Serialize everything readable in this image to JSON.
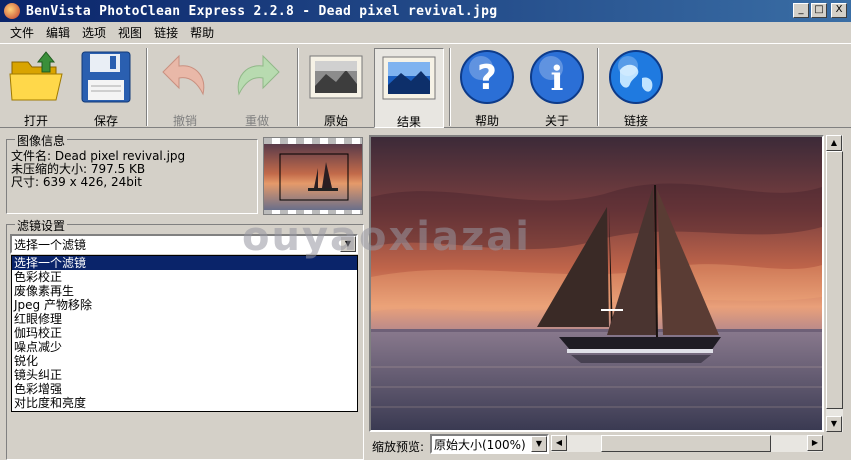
{
  "window": {
    "title": "BenVista PhotoClean Express 2.2.8 - Dead pixel revival.jpg",
    "controls": {
      "minimize": "_",
      "maximize": "□",
      "close": "X"
    }
  },
  "menu": [
    "文件",
    "编辑",
    "选项",
    "视图",
    "链接",
    "帮助"
  ],
  "toolbar": {
    "open": "打开",
    "save": "保存",
    "undo": "撤销",
    "redo": "重做",
    "original": "原始",
    "result": "结果",
    "help": "帮助",
    "about": "关于",
    "link": "链接"
  },
  "image_info": {
    "group_title": "图像信息",
    "filename": "文件名: Dead pixel revival.jpg",
    "uncompressed": "未压缩的大小: 797.5 KB",
    "dimensions": "尺寸: 639 x 426, 24bit"
  },
  "filter": {
    "group_title": "滤镜设置",
    "selected": "选择一个滤镜",
    "options": [
      "选择一个滤镜",
      "色彩校正",
      "废像素再生",
      "Jpeg 产物移除",
      "红眼修理",
      "伽玛校正",
      "噪点减少",
      "锐化",
      "镜头纠正",
      "色彩增强",
      "对比度和亮度"
    ]
  },
  "zoom": {
    "label": "缩放预览:",
    "value": "原始大小(100%)"
  },
  "watermark": "ouyaoxiazai",
  "icons": {
    "open": "folder-open-icon",
    "save": "floppy-disk-icon",
    "undo": "undo-arrow-icon",
    "redo": "redo-arrow-icon",
    "original": "photo-original-icon",
    "result": "photo-result-icon",
    "help": "question-icon",
    "about": "info-icon",
    "link": "globe-icon"
  }
}
